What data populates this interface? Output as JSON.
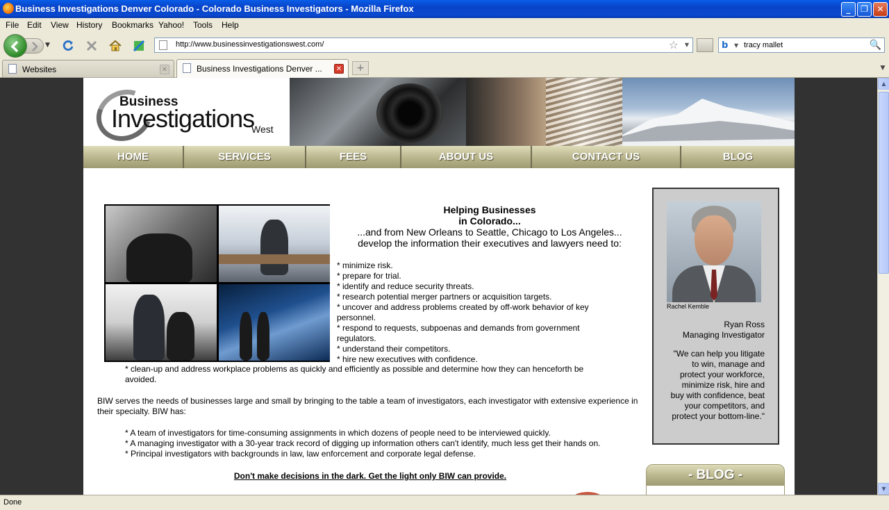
{
  "window": {
    "title": "Business Investigations Denver Colorado - Colorado Business Investigators - Mozilla Firefox",
    "minimize": "_",
    "maximize": "❐",
    "close": "✕"
  },
  "menu": [
    "File",
    "Edit",
    "View",
    "History",
    "Bookmarks",
    "Yahoo!",
    "Tools",
    "Help"
  ],
  "address": {
    "url": "http://www.businessinvestigationswest.com/"
  },
  "search": {
    "value": "tracy mallet"
  },
  "tabs": [
    {
      "label": "Websites",
      "active": false
    },
    {
      "label": "Business Investigations Denver ...",
      "active": true
    }
  ],
  "site": {
    "logo": {
      "business": "Business",
      "investigations": "Investigations",
      "west": "West"
    },
    "nav": [
      "HOME",
      "SERVICES",
      "FEES",
      "ABOUT US",
      "CONTACT US",
      "BLOG"
    ],
    "headline": {
      "line1": "Helping Businesses",
      "line2": "in Colorado...",
      "line3": "...and from New Orleans to Seattle, Chicago to Los Angeles...",
      "line4": "develop the information their executives and lawyers need to:"
    },
    "bullets": [
      "* minimize risk.",
      "* prepare for trial.",
      "* identify and reduce security threats.",
      "* research potential merger partners or acquisition targets.",
      "* uncover and address problems created by off-work behavior of key personnel.",
      "* respond to requests, subpoenas and demands from government regulators.",
      "* understand their competitors.",
      "* hire new executives with confidence."
    ],
    "cleanup": "* clean-up and address workplace problems as quickly and efficiently as possible and determine how they can henceforth be avoided.",
    "biw_paragraph": "BIW serves the needs of businesses large and small by bringing to the table a team of investigators, each investigator with extensive experience in their specialty. BIW has:",
    "has_items": [
      "* A team of investigators for time-consuming assignments in which dozens of people need to be interviewed quickly.",
      "* A managing investigator with a 30-year track record of digging up information others can't identify, much less get their hands on.",
      "* Principal investigators with backgrounds in law, law enforcement and corporate legal defense."
    ],
    "tagline": "Don't make decisions in the dark. Get the light only BIW can provide.",
    "sidebar": {
      "photo_caption": "Rachel Kemble",
      "name": "Ryan Ross",
      "role": "Managing Investigator",
      "quote": "\"We can help you litigate to win, manage and protect your workforce, minimize risk, hire and buy with confidence, beat your competitors, and protect your bottom-line.\""
    },
    "blog_heading": "- BLOG -"
  },
  "status": "Done"
}
